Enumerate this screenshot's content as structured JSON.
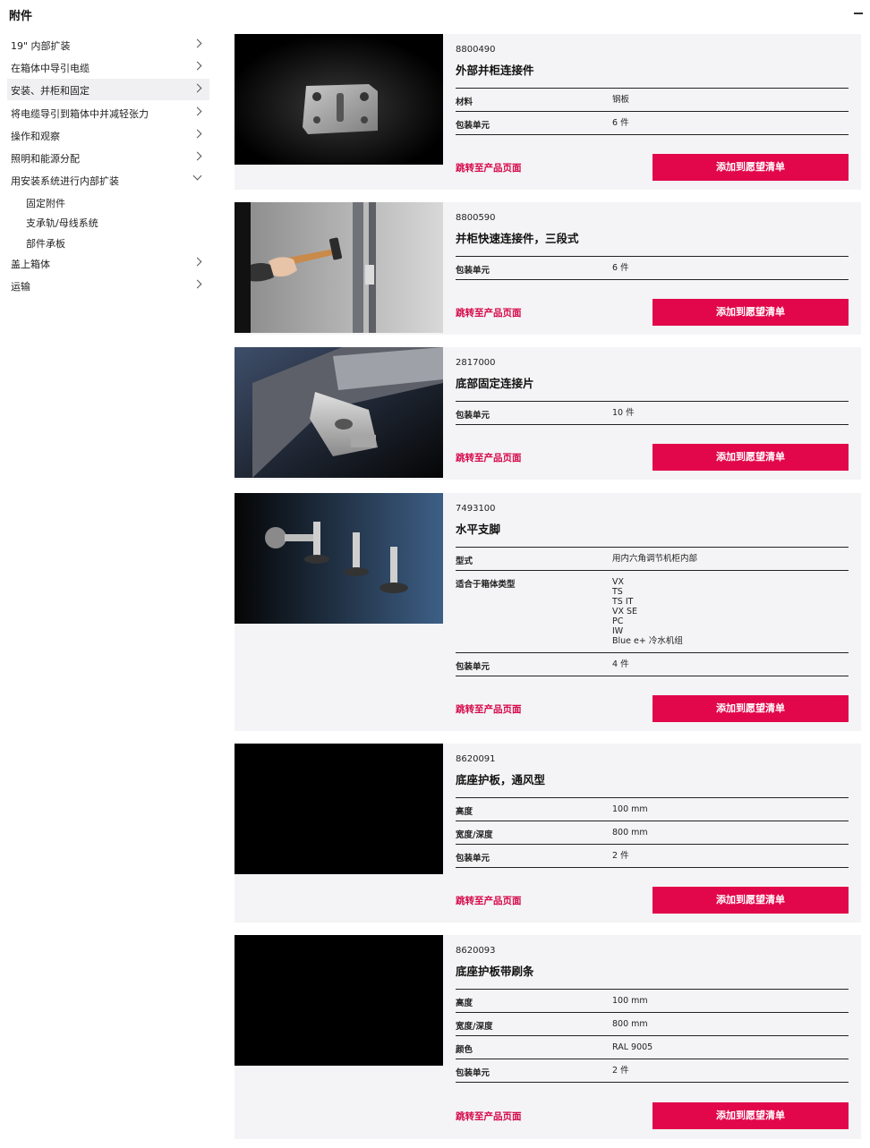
{
  "header": {
    "title": "附件"
  },
  "sidebar": {
    "items": [
      {
        "label": "19\" 内部扩装"
      },
      {
        "label": "在箱体中导引电缆"
      },
      {
        "label": "安装、并柜和固定"
      },
      {
        "label": "将电缆导引到箱体中并减轻张力"
      },
      {
        "label": "操作和观察"
      },
      {
        "label": "照明和能源分配"
      },
      {
        "label": "用安装系统进行内部扩装"
      },
      {
        "label": "盖上箱体"
      },
      {
        "label": "运输"
      }
    ],
    "subitems": [
      {
        "label": "固定附件"
      },
      {
        "label": "支承轨/母线系统"
      },
      {
        "label": "部件承板"
      }
    ]
  },
  "products": [
    {
      "art_no": "8800490",
      "name": "外部并柜连接件",
      "specs": [
        {
          "key": "材料",
          "value": "钢板"
        },
        {
          "key": "包装单元",
          "value": "6 件"
        }
      ],
      "link": "跳转至产品页面",
      "button": "添加到愿望清单"
    },
    {
      "art_no": "8800590",
      "name": "并柜快速连接件，三段式",
      "specs": [
        {
          "key": "包装单元",
          "value": "6 件"
        }
      ],
      "link": "跳转至产品页面",
      "button": "添加到愿望清单"
    },
    {
      "art_no": "2817000",
      "name": "底部固定连接片",
      "specs": [
        {
          "key": "包装单元",
          "value": "10 件"
        }
      ],
      "link": "跳转至产品页面",
      "button": "添加到愿望清单"
    },
    {
      "art_no": "7493100",
      "name": "水平支脚",
      "specs": [
        {
          "key": "型式",
          "value": "用内六角调节机柜内部"
        },
        {
          "key": "适合于箱体类型",
          "values": [
            "VX",
            "TS",
            "TS IT",
            "VX SE",
            "PC",
            "IW",
            "Blue e+ 冷水机组"
          ]
        },
        {
          "key": "包装单元",
          "value": "4 件"
        }
      ],
      "link": "跳转至产品页面",
      "button": "添加到愿望清单"
    },
    {
      "art_no": "8620091",
      "name": "底座护板，通风型",
      "specs": [
        {
          "key": "高度",
          "value": "100 mm"
        },
        {
          "key": "宽度/深度",
          "value": "800 mm"
        },
        {
          "key": "包装单元",
          "value": "2 件"
        }
      ],
      "link": "跳转至产品页面",
      "button": "添加到愿望清单"
    },
    {
      "art_no": "8620093",
      "name": "底座护板带刷条",
      "specs": [
        {
          "key": "高度",
          "value": "100 mm"
        },
        {
          "key": "宽度/深度",
          "value": "800 mm"
        },
        {
          "key": "颜色",
          "value": "RAL 9005"
        },
        {
          "key": "包装单元",
          "value": "2 件"
        }
      ],
      "link": "跳转至产品页面",
      "button": "添加到愿望清单"
    }
  ],
  "colors": {
    "accent": "#e2064a",
    "link": "#d6084a",
    "card_bg": "#f4f4f6"
  }
}
